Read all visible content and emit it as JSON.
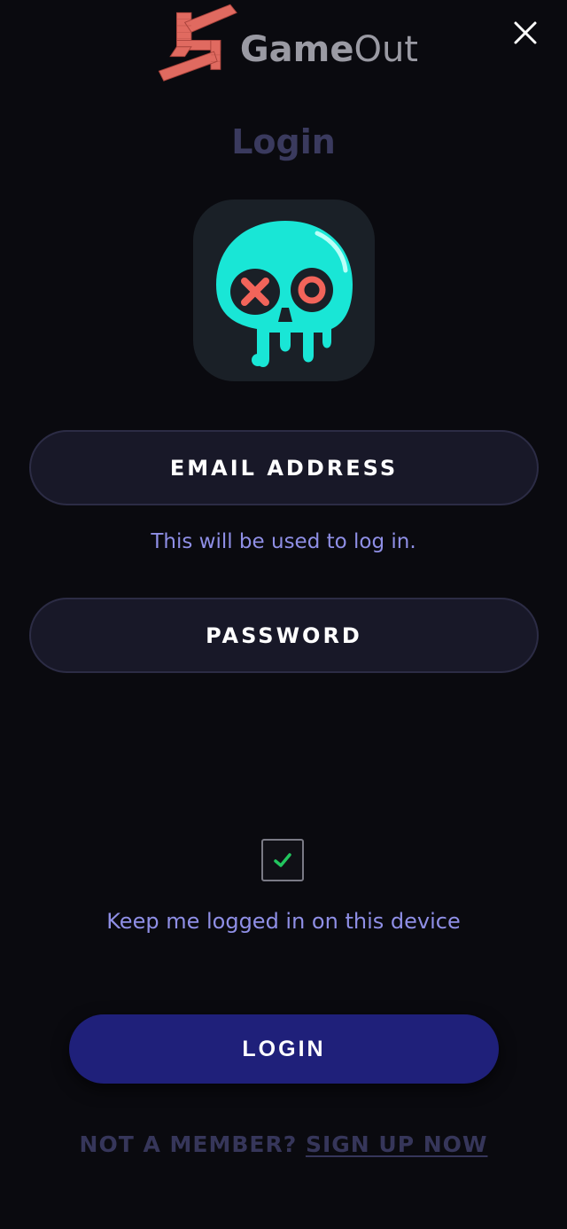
{
  "header": {
    "brand_name_bold": "Game",
    "brand_name_light": "Out",
    "close_icon": "close-icon"
  },
  "login": {
    "title": "Login",
    "email_placeholder": "EMAIL ADDRESS",
    "email_hint": "This will be used to log in.",
    "password_placeholder": "PASSWORD",
    "keep_logged_in_checked": true,
    "keep_logged_in_label": "Keep me logged in on this device",
    "login_button": "LOGIN",
    "not_member_text": "NOT A MEMBER?",
    "signup_link": "SIGN UP NOW"
  },
  "colors": {
    "background": "#0a0a0f",
    "accent_text": "#8f8fe6",
    "button_bg": "#1f207a",
    "muted_title": "#3a3a5e",
    "check_green": "#22c55e",
    "icon_teal": "#19e6d6",
    "icon_red": "#f2645a"
  }
}
